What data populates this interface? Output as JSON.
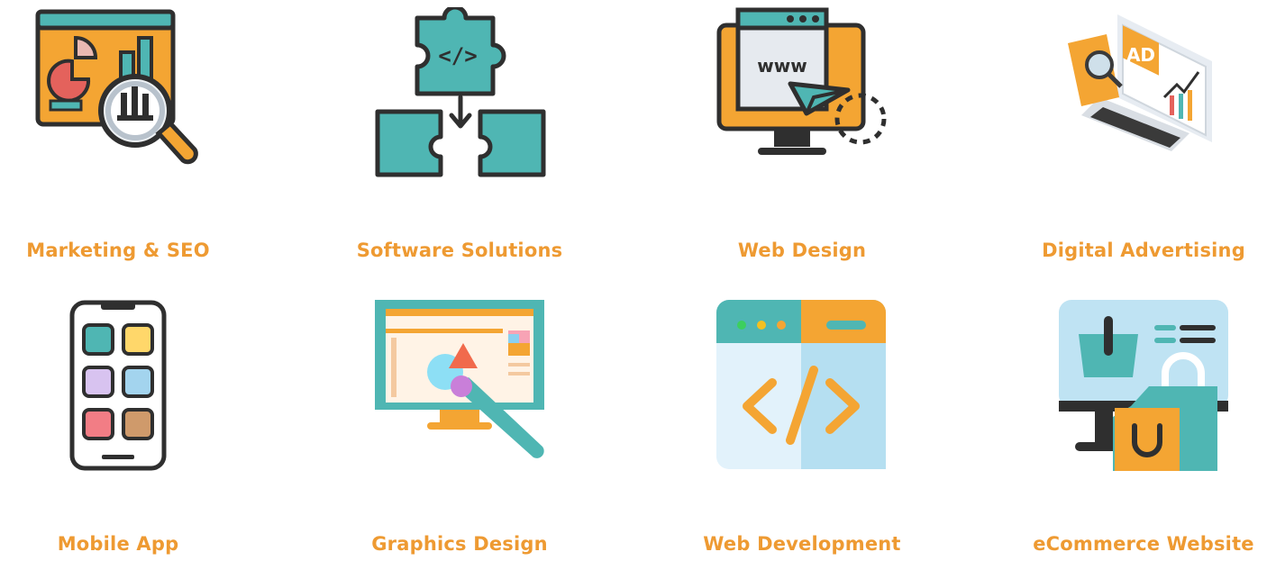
{
  "services": [
    {
      "label": "Marketing & SEO",
      "icon": "marketing-seo-icon"
    },
    {
      "label": "Software Solutions",
      "icon": "software-solutions-icon"
    },
    {
      "label": "Web Design",
      "icon": "web-design-icon"
    },
    {
      "label": "Digital Advertising",
      "icon": "digital-advertising-icon"
    },
    {
      "label": "Mobile App",
      "icon": "mobile-app-icon"
    },
    {
      "label": "Graphics Design",
      "icon": "graphics-design-icon"
    },
    {
      "label": "Web Development",
      "icon": "web-development-icon"
    },
    {
      "label": "eCommerce Website",
      "icon": "ecommerce-website-icon"
    }
  ],
  "icons": {
    "web_design_url_text": "www",
    "ad_badge_text": "AD"
  },
  "colors": {
    "label": "#ee9a32",
    "orange": "#f4a533",
    "teal": "#4fb6b3",
    "dark": "#3a3a3a"
  }
}
